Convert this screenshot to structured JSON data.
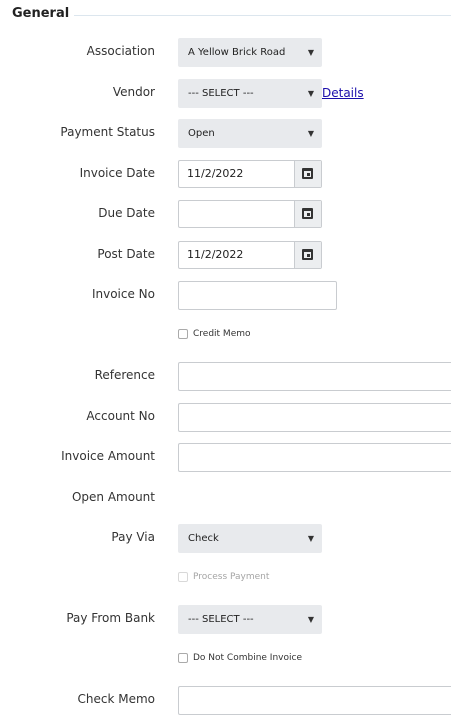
{
  "section": {
    "title": "General"
  },
  "fields": {
    "association": {
      "label": "Association",
      "value": "A Yellow Brick Road"
    },
    "vendor": {
      "label": "Vendor",
      "value": "--- SELECT ---",
      "details_link": "Details"
    },
    "payment_status": {
      "label": "Payment Status",
      "value": "Open"
    },
    "invoice_date": {
      "label": "Invoice Date",
      "value": "11/2/2022"
    },
    "due_date": {
      "label": "Due Date",
      "value": ""
    },
    "post_date": {
      "label": "Post Date",
      "value": "11/2/2022"
    },
    "invoice_no": {
      "label": "Invoice No",
      "value": ""
    },
    "credit_memo": {
      "label": "Credit Memo",
      "checked": false
    },
    "reference": {
      "label": "Reference",
      "value": ""
    },
    "account_no": {
      "label": "Account No",
      "value": ""
    },
    "invoice_amount": {
      "label": "Invoice Amount",
      "value": ""
    },
    "open_amount": {
      "label": "Open Amount"
    },
    "pay_via": {
      "label": "Pay Via",
      "value": "Check"
    },
    "process_payment": {
      "label": "Process Payment",
      "checked": false,
      "disabled": true
    },
    "pay_from_bank": {
      "label": "Pay From Bank",
      "value": "--- SELECT ---"
    },
    "do_not_combine": {
      "label": "Do Not Combine Invoice",
      "checked": false
    },
    "check_memo": {
      "label": "Check Memo",
      "value": ""
    }
  }
}
